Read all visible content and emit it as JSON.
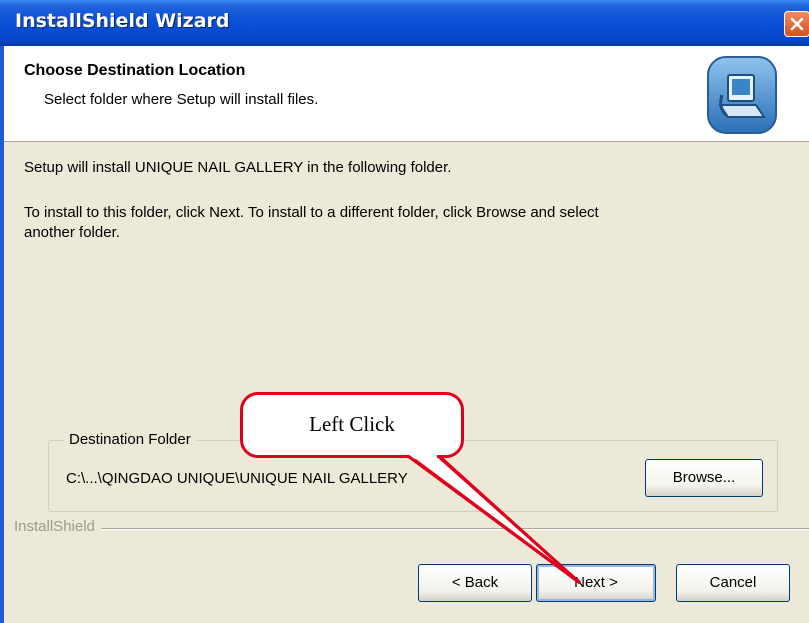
{
  "window": {
    "title": "InstallShield Wizard",
    "title_color": "#0a4fd6"
  },
  "header": {
    "title": "Choose Destination Location",
    "subtitle": "Select folder where Setup will install files."
  },
  "body": {
    "line1": "Setup will install UNIQUE NAIL GALLERY in the following folder.",
    "line2": "To install to this folder, click Next. To install to a different folder, click Browse and select",
    "line3": "another folder."
  },
  "destination": {
    "group_label": "Destination Folder",
    "path": "C:\\...\\QINGDAO UNIQUE\\UNIQUE NAIL GALLERY",
    "browse_label": "Browse..."
  },
  "footer": {
    "brand": "InstallShield",
    "back_label": "< Back",
    "next_label": "Next >",
    "cancel_label": "Cancel"
  },
  "annotation": {
    "text": "Left Click",
    "color": "#e0001b"
  },
  "icons": [
    "close-icon",
    "setup-computer-icon"
  ]
}
